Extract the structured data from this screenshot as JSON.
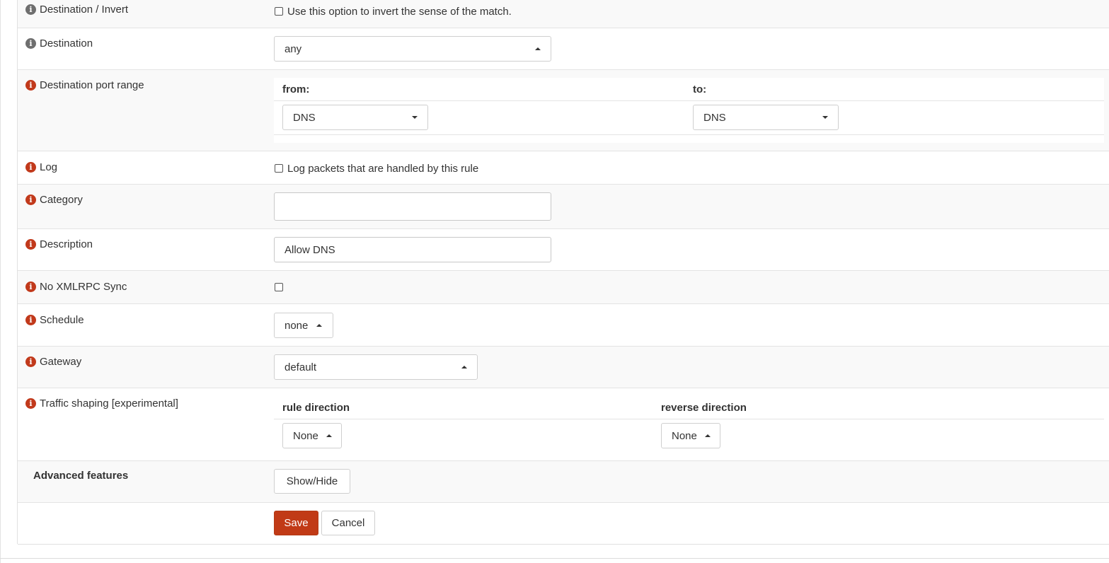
{
  "colors": {
    "accent": "#c13a16",
    "info_grey": "#6e6e6e",
    "info_red": "#c1391b"
  },
  "icons": {
    "info": "info-circle-icon",
    "caret_up": "caret-up-icon",
    "caret_down": "caret-down-icon"
  },
  "rows": {
    "dest_invert": {
      "label": "Destination / Invert",
      "checkbox_text": "Use this option to invert the sense of the match.",
      "checked": false
    },
    "destination": {
      "label": "Destination",
      "value": "any"
    },
    "dest_port_range": {
      "label": "Destination port range",
      "from_label": "from:",
      "to_label": "to:",
      "from_value": "DNS",
      "to_value": "DNS"
    },
    "log": {
      "label": "Log",
      "checkbox_text": "Log packets that are handled by this rule",
      "checked": false
    },
    "category": {
      "label": "Category",
      "value": ""
    },
    "description": {
      "label": "Description",
      "value": "Allow DNS"
    },
    "no_xmlrpc": {
      "label": "No XMLRPC Sync",
      "checked": false
    },
    "schedule": {
      "label": "Schedule",
      "value": "none"
    },
    "gateway": {
      "label": "Gateway",
      "value": "default"
    },
    "traffic_shaping": {
      "label": "Traffic shaping [experimental]",
      "rule_direction_label": "rule direction",
      "reverse_direction_label": "reverse direction",
      "rule_direction_value": "None",
      "reverse_direction_value": "None"
    },
    "advanced": {
      "label": "Advanced features",
      "button": "Show/Hide"
    }
  },
  "actions": {
    "save": "Save",
    "cancel": "Cancel"
  }
}
